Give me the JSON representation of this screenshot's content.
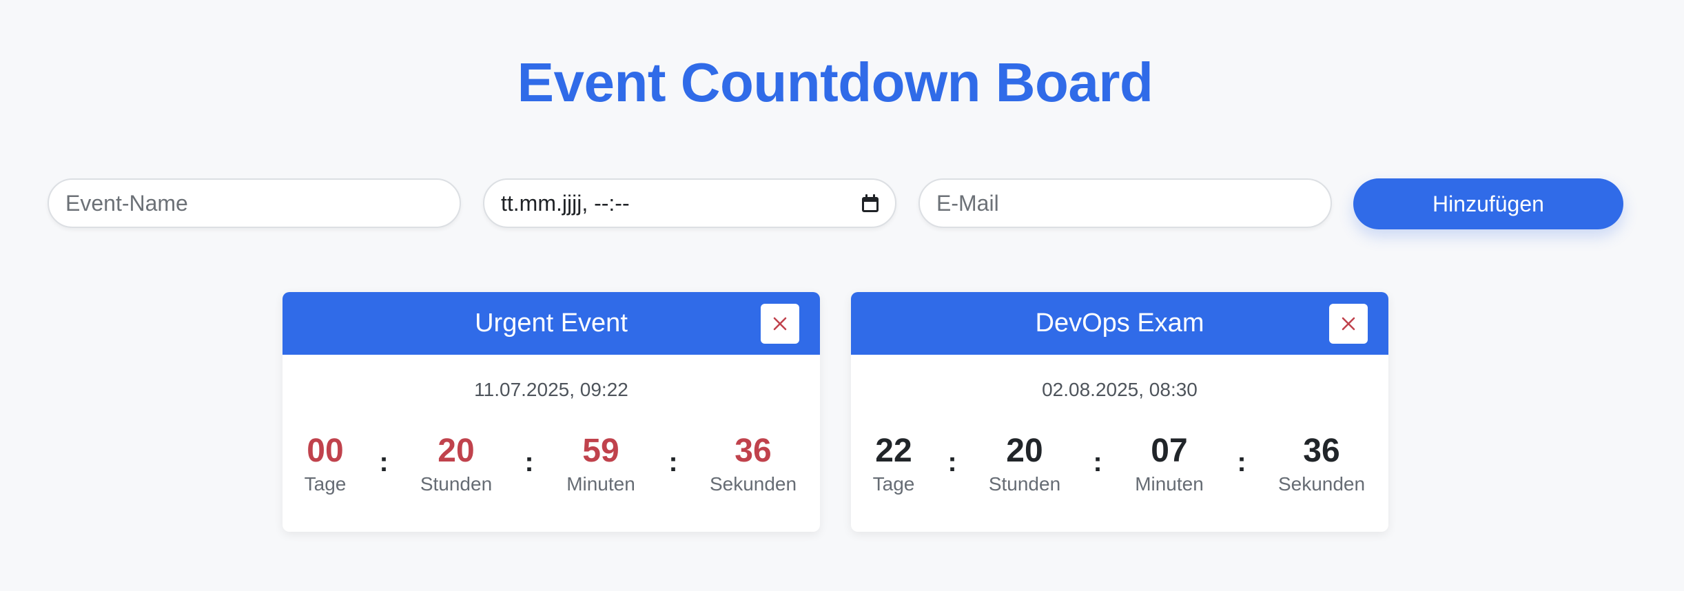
{
  "title": "Event Countdown Board",
  "form": {
    "name_placeholder": "Event-Name",
    "date_placeholder": "tt.mm.jjjj, --:--",
    "email_placeholder": "E-Mail",
    "add_label": "Hinzufügen"
  },
  "labels": {
    "days": "Tage",
    "hours": "Stunden",
    "minutes": "Minuten",
    "seconds": "Sekunden",
    "separator": ":",
    "close": "✕"
  },
  "events": [
    {
      "title": "Urgent Event",
      "date": "11.07.2025, 09:22",
      "days": "00",
      "hours": "20",
      "minutes": "59",
      "seconds": "36",
      "urgent": true
    },
    {
      "title": "DevOps Exam",
      "date": "02.08.2025, 08:30",
      "days": "22",
      "hours": "20",
      "minutes": "07",
      "seconds": "36",
      "urgent": false
    }
  ],
  "colors": {
    "accent": "#306be8",
    "urgent": "#c0424c",
    "background": "#f7f8fa"
  }
}
